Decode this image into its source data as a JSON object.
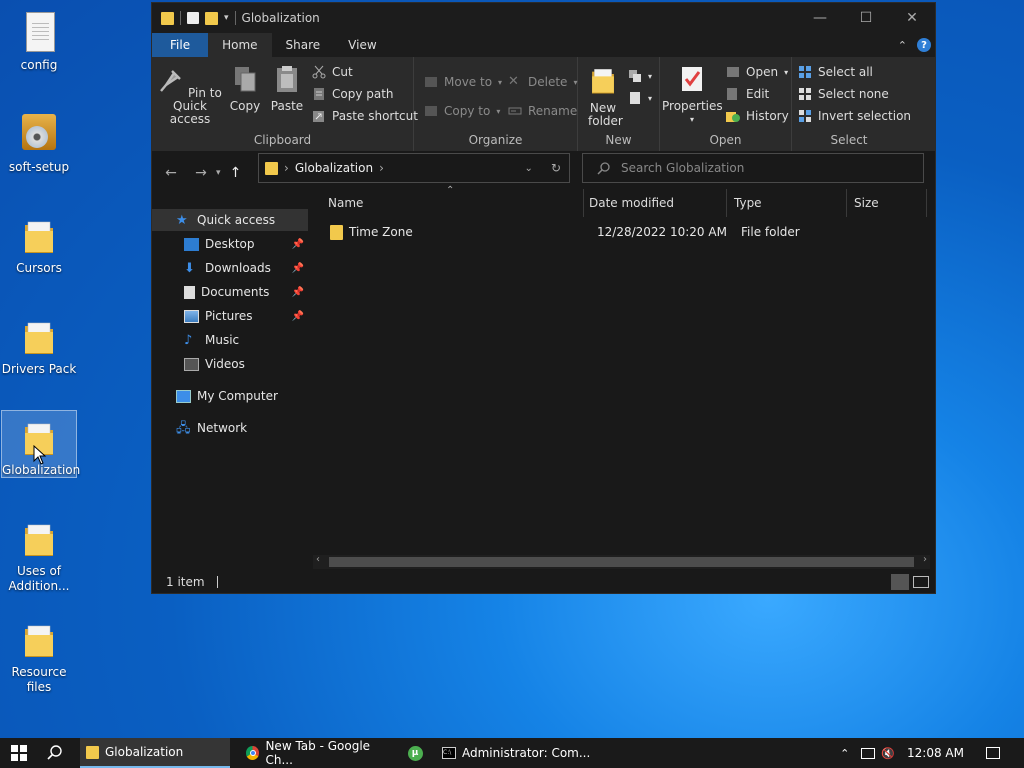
{
  "desktop": {
    "icons": [
      {
        "label": "config"
      },
      {
        "label": "soft-setup"
      },
      {
        "label": "Cursors"
      },
      {
        "label": "Drivers Pack"
      },
      {
        "label": "Globalization"
      },
      {
        "label": "Uses of Addition..."
      },
      {
        "label": "Resource files"
      }
    ]
  },
  "window": {
    "title": "Globalization",
    "controls": {
      "minimize": "—",
      "maximize": "☐",
      "close": "✕"
    },
    "tabs": [
      {
        "label": "File"
      },
      {
        "label": "Home"
      },
      {
        "label": "Share"
      },
      {
        "label": "View"
      }
    ],
    "help": "?",
    "ribbon": {
      "clipboard": {
        "label": "Clipboard",
        "pin": "Pin to Quick access",
        "copy": "Copy",
        "paste": "Paste",
        "cut": "Cut",
        "copy_path": "Copy path",
        "paste_shortcut": "Paste shortcut"
      },
      "organize": {
        "label": "Organize",
        "move_to": "Move to",
        "copy_to": "Copy to",
        "delete": "Delete",
        "rename": "Rename"
      },
      "new": {
        "label": "New",
        "new_folder": "New folder"
      },
      "open": {
        "label": "Open",
        "properties": "Properties",
        "open": "Open",
        "edit": "Edit",
        "history": "History"
      },
      "select": {
        "label": "Select",
        "select_all": "Select all",
        "select_none": "Select none",
        "invert": "Invert selection"
      }
    },
    "address": {
      "crumb": "Globalization"
    },
    "search": {
      "placeholder": "Search Globalization"
    },
    "nav": {
      "quick_access": "Quick access",
      "desktop": "Desktop",
      "downloads": "Downloads",
      "documents": "Documents",
      "pictures": "Pictures",
      "music": "Music",
      "videos": "Videos",
      "my_computer": "My Computer",
      "network": "Network"
    },
    "columns": {
      "name": "Name",
      "date": "Date modified",
      "type": "Type",
      "size": "Size"
    },
    "files": [
      {
        "name": "Time Zone",
        "date": "12/28/2022 10:20 AM",
        "type": "File folder",
        "size": ""
      }
    ],
    "status": "1 item"
  },
  "taskbar": {
    "items": [
      {
        "label": "Globalization"
      },
      {
        "label": "New Tab - Google Ch..."
      },
      {
        "label": "Administrator:  Com..."
      }
    ],
    "clock": "12:08 AM"
  },
  "colors": {
    "accent": "#1e5a9c",
    "folder": "#f2c94c",
    "taskbar": "#1a1a1a"
  }
}
